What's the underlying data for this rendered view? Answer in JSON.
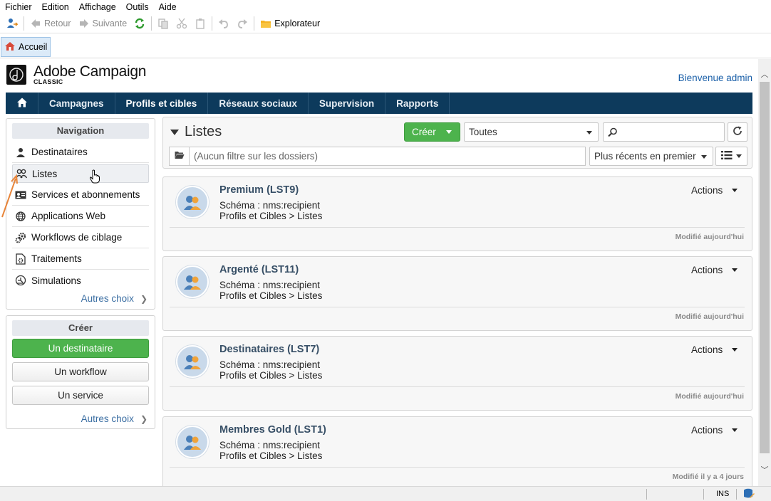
{
  "menu": [
    "Fichier",
    "Edition",
    "Affichage",
    "Outils",
    "Aide"
  ],
  "toolbar": {
    "back": "Retour",
    "forward": "Suivante",
    "explorer": "Explorateur"
  },
  "tab": {
    "label": "Accueil"
  },
  "header": {
    "brand": "Adobe Campaign",
    "brand_sub": "CLASSIC",
    "welcome": "Bienvenue admin"
  },
  "mainnav": [
    "Campagnes",
    "Profils et cibles",
    "Réseaux sociaux",
    "Supervision",
    "Rapports"
  ],
  "navigation": {
    "title": "Navigation",
    "items": [
      {
        "label": "Destinataires",
        "icon": "person-icon"
      },
      {
        "label": "Listes",
        "icon": "group-icon"
      },
      {
        "label": "Services et abonnements",
        "icon": "id-card-icon"
      },
      {
        "label": "Applications Web",
        "icon": "globe-icon"
      },
      {
        "label": "Workflows de ciblage",
        "icon": "gears-icon"
      },
      {
        "label": "Traitements",
        "icon": "process-icon"
      },
      {
        "label": "Simulations",
        "icon": "gauge-icon"
      }
    ],
    "more": "Autres choix"
  },
  "create": {
    "title": "Créer",
    "buttons": [
      "Un destinataire",
      "Un workflow",
      "Un service"
    ],
    "more": "Autres choix"
  },
  "list": {
    "title": "Listes",
    "create_button": "Créer",
    "filter_select": "Toutes",
    "search_placeholder": "",
    "folder_filter": "(Aucun filtre sur les dossiers)",
    "sort": "Plus récents en premier"
  },
  "items": [
    {
      "title": "Premium (LST9)",
      "schema": "Schéma : nms:recipient",
      "path": "Profils et Cibles > Listes",
      "actions": "Actions",
      "modified": "Modifié aujourd'hui"
    },
    {
      "title": "Argenté (LST11)",
      "schema": "Schéma : nms:recipient",
      "path": "Profils et Cibles > Listes",
      "actions": "Actions",
      "modified": "Modifié aujourd'hui"
    },
    {
      "title": "Destinataires (LST7)",
      "schema": "Schéma : nms:recipient",
      "path": "Profils et Cibles > Listes",
      "actions": "Actions",
      "modified": "Modifié aujourd'hui"
    },
    {
      "title": "Membres Gold (LST1)",
      "schema": "Schéma : nms:recipient",
      "path": "Profils et Cibles > Listes",
      "actions": "Actions",
      "modified": "Modifié il y a 4 jours"
    }
  ],
  "status": {
    "ins": "INS"
  },
  "colors": {
    "nav_bg": "#0d3a5c",
    "accent_green": "#4db34d",
    "link": "#1a5fa8"
  }
}
